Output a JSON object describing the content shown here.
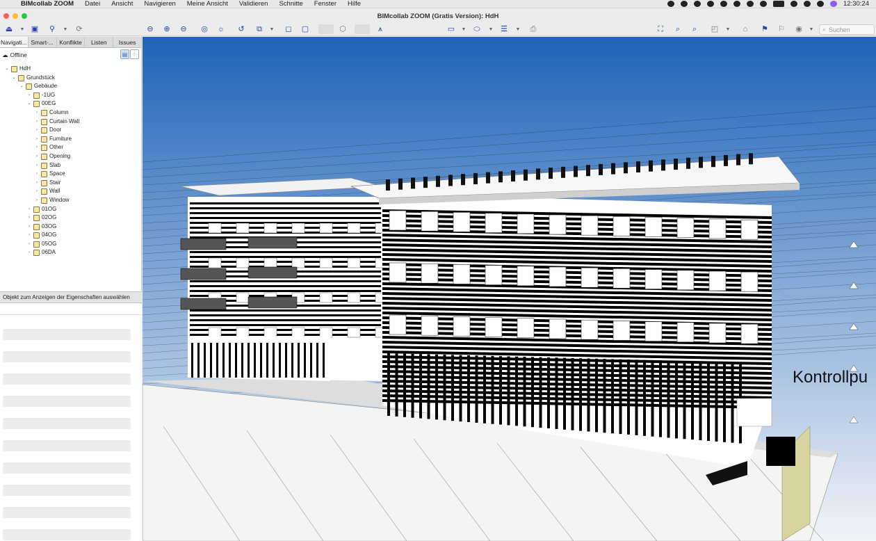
{
  "menubar": {
    "app_name": "BIMcollab ZOOM",
    "items": [
      "Datei",
      "Ansicht",
      "Navigieren",
      "Meine Ansicht",
      "Validieren",
      "Schnitte",
      "Fenster",
      "Hilfe"
    ],
    "clock": "12:30:24"
  },
  "window": {
    "title": "BIMcollab ZOOM (Gratis Version): HdH"
  },
  "toolbar": {
    "search_placeholder": "Suchen",
    "icons": [
      "model-icon",
      "save-icon",
      "share-icon",
      "sync-icon",
      "zoom-out-icon",
      "zoom-in-icon",
      "zoom-minus-icon",
      "select-icon",
      "fit-icon",
      "rotate-icon",
      "box-icon",
      "section-icon",
      "cube-icon",
      "perspective-icon",
      "bcf-icon",
      "measure-icon",
      "eye-icon",
      "layers-icon",
      "camera-icon",
      "fullscreen-icon",
      "zoom-region-icon",
      "zoom-select-icon",
      "isolate-icon",
      "home-icon",
      "pin-icon",
      "hide-icon",
      "visibility-icon"
    ]
  },
  "sidebar": {
    "tabs": [
      "Navigati...",
      "Smart-...",
      "Konflikte",
      "Listen",
      "Issues"
    ],
    "active_tab": "Navigati...",
    "status": "Offline",
    "tree": [
      {
        "label": "HdH",
        "level": 0,
        "expanded": true
      },
      {
        "label": "Grundstück",
        "level": 1,
        "expanded": true
      },
      {
        "label": "Gebäude",
        "level": 2,
        "expanded": true
      },
      {
        "label": "-1UG",
        "level": 3,
        "expanded": false
      },
      {
        "label": "00EG",
        "level": 3,
        "expanded": true
      },
      {
        "label": "Column",
        "level": 4,
        "expanded": false
      },
      {
        "label": "Curtain Wall",
        "level": 4,
        "expanded": false
      },
      {
        "label": "Door",
        "level": 4,
        "expanded": false
      },
      {
        "label": "Furniture",
        "level": 4,
        "expanded": false
      },
      {
        "label": "Other",
        "level": 4,
        "expanded": false
      },
      {
        "label": "Opening",
        "level": 4,
        "expanded": false
      },
      {
        "label": "Slab",
        "level": 4,
        "expanded": false
      },
      {
        "label": "Space",
        "level": 4,
        "expanded": false
      },
      {
        "label": "Stair",
        "level": 4,
        "expanded": false
      },
      {
        "label": "Wall",
        "level": 4,
        "expanded": false
      },
      {
        "label": "Window",
        "level": 4,
        "expanded": false
      },
      {
        "label": "01OG",
        "level": 3,
        "expanded": false
      },
      {
        "label": "02OG",
        "level": 3,
        "expanded": false
      },
      {
        "label": "03OG",
        "level": 3,
        "expanded": false
      },
      {
        "label": "04OG",
        "level": 3,
        "expanded": false
      },
      {
        "label": "05OG",
        "level": 3,
        "expanded": false
      },
      {
        "label": "06DA",
        "level": 3,
        "expanded": false
      }
    ],
    "properties_prompt": "Objekt zum Anzeigen der Eigenschaften auswählen"
  },
  "viewport": {
    "model_label": "Kontrollpu",
    "sky_top": "#1e63b8",
    "sky_bottom": "#f2f4f8"
  }
}
